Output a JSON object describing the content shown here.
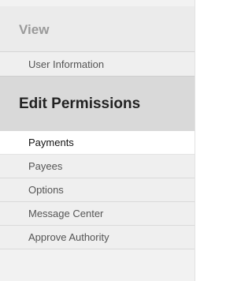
{
  "nav": {
    "view_heading": "View",
    "view_items": [
      {
        "label": "User Information"
      }
    ],
    "edit_heading": "Edit Permissions",
    "edit_items": [
      {
        "label": "Payments",
        "active": true
      },
      {
        "label": "Payees"
      },
      {
        "label": "Options"
      },
      {
        "label": "Message Center"
      },
      {
        "label": "Approve Authority"
      }
    ]
  }
}
